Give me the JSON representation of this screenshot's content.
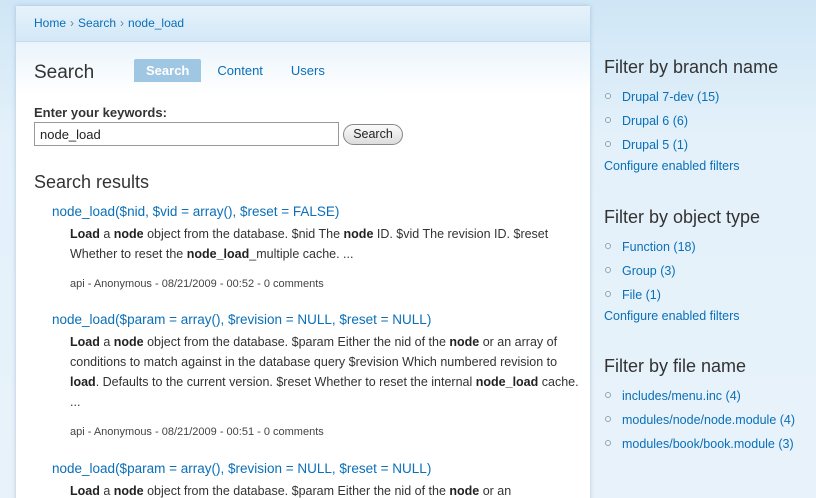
{
  "breadcrumb": {
    "items": [
      "Home",
      "Search",
      "node_load"
    ],
    "sep": "›"
  },
  "page": {
    "title": "Search"
  },
  "tabs": [
    {
      "label": "Search",
      "active": true
    },
    {
      "label": "Content",
      "active": false
    },
    {
      "label": "Users",
      "active": false
    }
  ],
  "search_form": {
    "label": "Enter your keywords:",
    "value": "node_load",
    "button_label": "Search"
  },
  "results": {
    "title": "Search results",
    "items": [
      {
        "title": "node_load($nid, $vid = array(), $reset = FALSE)",
        "snippet_html": "<b>Load</b> a <b>node</b> object from the database. $nid The <b>node</b> ID. $vid The revision ID. $reset Whether to reset the <b>node_load</b>_multiple cache. ...",
        "meta": "api - Anonymous - 08/21/2009 - 00:52 - 0 comments"
      },
      {
        "title": "node_load($param = array(), $revision = NULL, $reset = NULL)",
        "snippet_html": "<b>Load</b> a <b>node</b> object from the database. $param Either the nid of the <b>node</b> or an array of conditions to match against in the database query $revision Which numbered revision to <b>load</b>. Defaults to the current version. $reset Whether to reset the internal <b>node_load</b> cache. ...",
        "meta": "api - Anonymous - 08/21/2009 - 00:51 - 0 comments"
      },
      {
        "title": "node_load($param = array(), $revision = NULL, $reset = NULL)",
        "snippet_html": "<b>Load</b> a <b>node</b> object from the database. $param Either the nid of the <b>node</b> or an",
        "meta": ""
      }
    ]
  },
  "sidebar": {
    "branch": {
      "title": "Filter by branch name",
      "items": [
        "Drupal 7-dev (15)",
        "Drupal 6 (6)",
        "Drupal 5 (1)"
      ],
      "configure": "Configure enabled filters"
    },
    "object_type": {
      "title": "Filter by object type",
      "items": [
        "Function (18)",
        "Group (3)",
        "File (1)"
      ],
      "configure": "Configure enabled filters"
    },
    "file_name": {
      "title": "Filter by file name",
      "items": [
        "includes/menu.inc (4)",
        "modules/node/node.module (4)",
        "modules/book/book.module (3)"
      ]
    }
  },
  "colors": {
    "link": "#0a6fb8",
    "tab_active_bg": "#9fc7e4",
    "page_bg": "#dceefa"
  }
}
